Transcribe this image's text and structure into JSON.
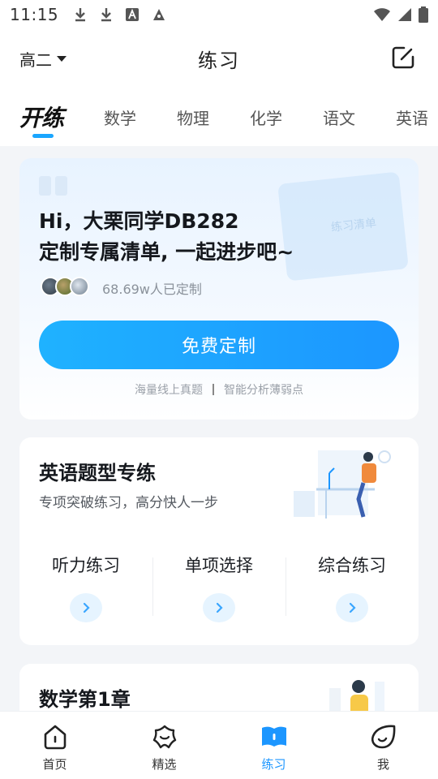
{
  "status_bar": {
    "time": "11:15"
  },
  "header": {
    "grade": "高二",
    "title": "练习"
  },
  "tabs": {
    "logo_text": "开练",
    "items": [
      "数学",
      "物理",
      "化学",
      "语文",
      "英语"
    ]
  },
  "hero": {
    "line1": "Hi，大栗同学DB282",
    "line2": "定制专属清单, 一起进步吧~",
    "count": "68.69w人已定制",
    "cta": "免费定制",
    "feature1": "海量线上真题",
    "feature2": "智能分析薄弱点",
    "deco_text": "练习清单"
  },
  "english_card": {
    "title": "英语题型专练",
    "subtitle": "专项突破练习，高分快人一步",
    "items": [
      "听力练习",
      "单项选择",
      "综合练习"
    ]
  },
  "math_card": {
    "title": "数学第1章"
  },
  "nav": {
    "items": [
      {
        "label": "首页",
        "icon": "home-icon"
      },
      {
        "label": "精选",
        "icon": "flower-icon"
      },
      {
        "label": "练习",
        "icon": "book-icon"
      },
      {
        "label": "我",
        "icon": "face-icon"
      }
    ],
    "active_color": "#1c96ff"
  },
  "colors": {
    "accent": "#1c96ff",
    "accent_light": "#e6f4ff"
  }
}
